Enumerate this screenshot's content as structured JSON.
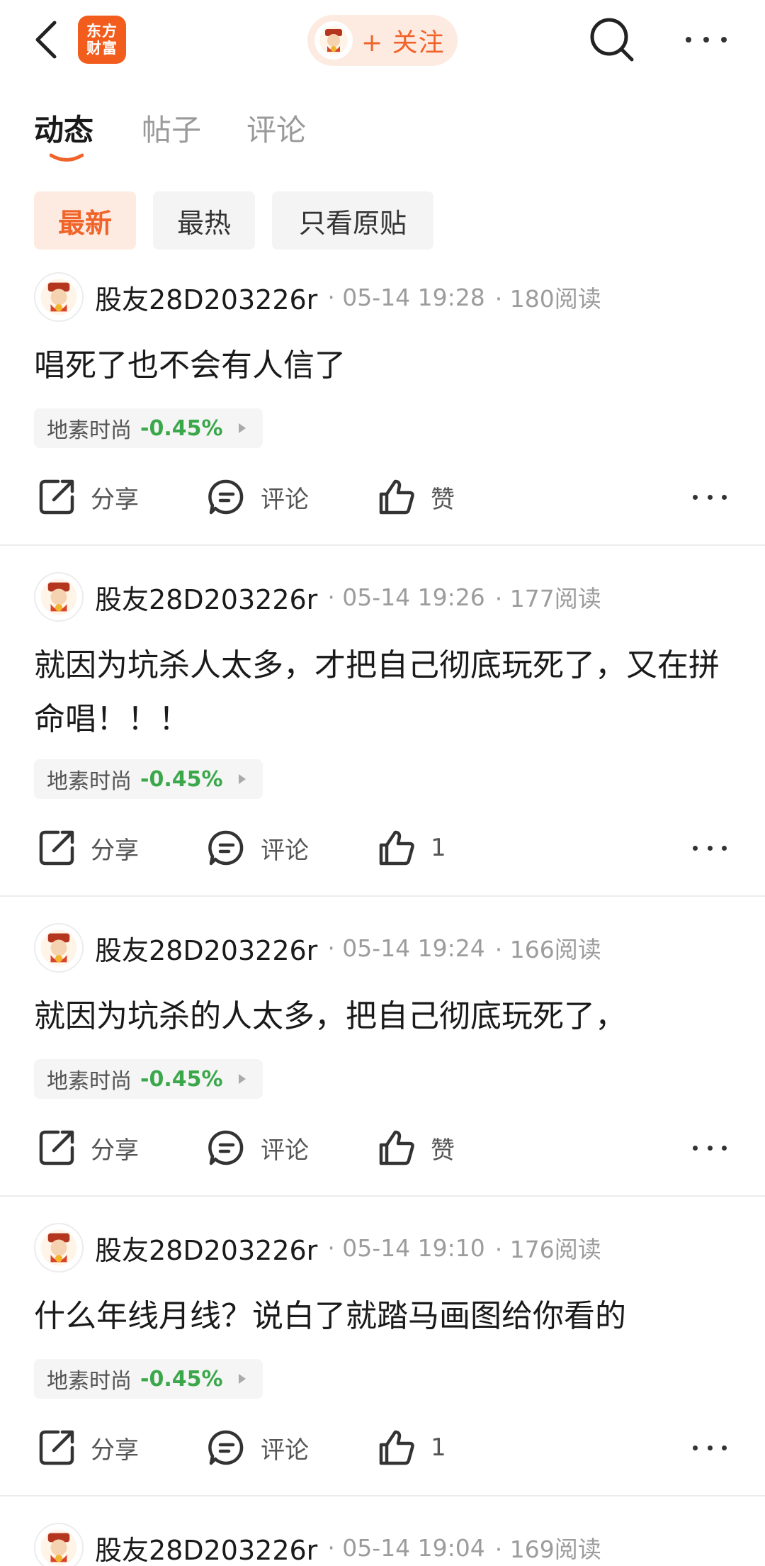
{
  "header": {
    "logo_line1": "东方",
    "logo_line2": "财富",
    "follow_label": "+ 关注"
  },
  "tabs": [
    {
      "label": "动态",
      "active": true
    },
    {
      "label": "帖子",
      "active": false
    },
    {
      "label": "评论",
      "active": false
    }
  ],
  "filters": [
    {
      "label": "最新",
      "active": true
    },
    {
      "label": "最热",
      "active": false
    },
    {
      "label": "只看原贴",
      "active": false
    }
  ],
  "colors": {
    "accent": "#f0642a",
    "down_green": "#3aa84a"
  },
  "posts": [
    {
      "user": "股友28D203226r",
      "time": "· 05-14 19:28",
      "reads": "· 180阅读",
      "text": "唱死了也不会有人信了",
      "tag_name": "地素时尚",
      "tag_change": "-0.45%",
      "share_label": "分享",
      "comment_label": "评论",
      "like_label": "赞"
    },
    {
      "user": "股友28D203226r",
      "time": "· 05-14 19:26",
      "reads": "· 177阅读",
      "text": "就因为坑杀人太多，才把自己彻底玩死了，又在拼命唱！！！",
      "tag_name": "地素时尚",
      "tag_change": "-0.45%",
      "share_label": "分享",
      "comment_label": "评论",
      "like_label": "1"
    },
    {
      "user": "股友28D203226r",
      "time": "· 05-14 19:24",
      "reads": "· 166阅读",
      "text": "就因为坑杀的人太多，把自己彻底玩死了，",
      "tag_name": "地素时尚",
      "tag_change": "-0.45%",
      "share_label": "分享",
      "comment_label": "评论",
      "like_label": "赞"
    },
    {
      "user": "股友28D203226r",
      "time": "· 05-14 19:10",
      "reads": "· 176阅读",
      "text": "什么年线月线？说白了就踏马画图给你看的",
      "tag_name": "地素时尚",
      "tag_change": "-0.45%",
      "share_label": "分享",
      "comment_label": "评论",
      "like_label": "1"
    },
    {
      "user": "股友28D203226r",
      "time": "· 05-14 19:04",
      "reads": "· 169阅读"
    }
  ]
}
